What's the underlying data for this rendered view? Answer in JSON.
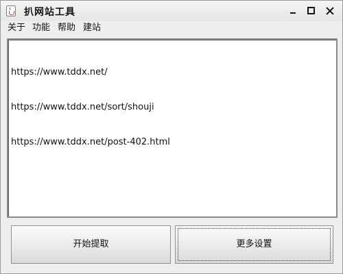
{
  "window": {
    "title": "扒网站工具",
    "controls": [
      "minimize-icon",
      "maximize-icon",
      "close-icon"
    ]
  },
  "menu": {
    "items": [
      {
        "label": "关于"
      },
      {
        "label": "功能"
      },
      {
        "label": "帮助"
      },
      {
        "label": "建站"
      }
    ]
  },
  "editor": {
    "lines": [
      "https://www.tddx.net/",
      "https://www.tddx.net/sort/shouji",
      "https://www.tddx.net/post-402.html"
    ]
  },
  "buttons": {
    "start_label": "开始提取",
    "settings_label": "更多设置"
  }
}
